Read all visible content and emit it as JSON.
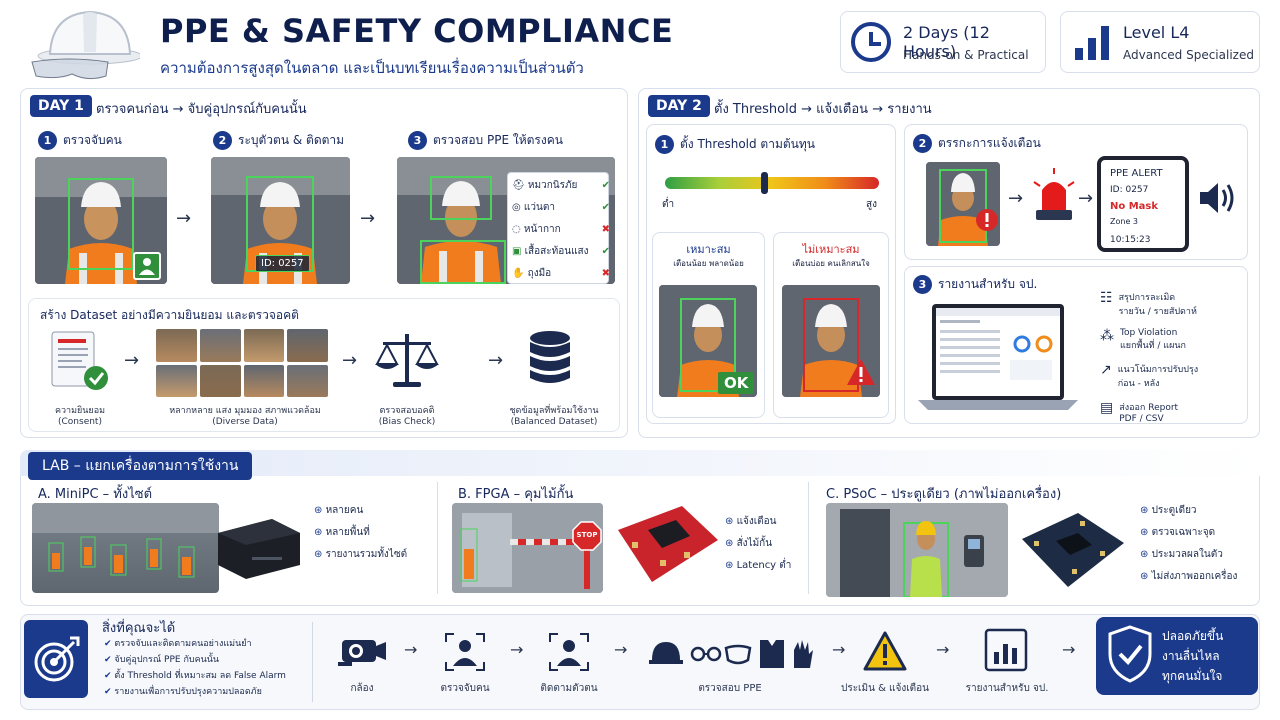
{
  "header": {
    "title": "PPE & SAFETY COMPLIANCE",
    "subtitle": "ความต้องการสูงสุดในตลาด และเป็นบทเรียนเรื่องความเป็นส่วนตัว",
    "duration_title": "2 Days (12 Hours)",
    "duration_sub": "Hands-on & Practical",
    "level_title": "Level L4",
    "level_sub": "Advanced Specialized"
  },
  "day1": {
    "tag": "DAY 1",
    "heading": "ตรวจคนก่อน → จับคู่อุปกรณ์กับคนนั้น",
    "steps": [
      {
        "num": "1",
        "label": "ตรวจจับคน"
      },
      {
        "num": "2",
        "label": "ระบุตัวตน & ติดตาม"
      },
      {
        "num": "3",
        "label": "ตรวจสอบ PPE ให้ตรงคน"
      }
    ],
    "id_label": "ID: 0257",
    "ppe_items": [
      {
        "label": "หมวกนิรภัย",
        "status": "✔"
      },
      {
        "label": "แว่นตา",
        "status": "✔"
      },
      {
        "label": "หน้ากาก",
        "status": "✖"
      },
      {
        "label": "เสื้อสะท้อนแสง",
        "status": "✔"
      },
      {
        "label": "ถุงมือ",
        "status": "✖"
      }
    ],
    "dataset_heading": "สร้าง Dataset อย่างมีความยินยอม และตรวจอคติ",
    "dataset_steps": [
      {
        "label": "ความยินยอม",
        "sub": "(Consent)"
      },
      {
        "label": "หลากหลาย แสง มุมมอง สภาพแวดล้อม",
        "sub": "(Diverse Data)"
      },
      {
        "label": "ตรวจสอบอคติ",
        "sub": "(Bias Check)"
      },
      {
        "label": "ชุดข้อมูลที่พร้อมใช้งาน",
        "sub": "(Balanced Dataset)"
      }
    ]
  },
  "day2": {
    "tag": "DAY 2",
    "heading": "ตั้ง Threshold → แจ้งเตือน → รายงาน",
    "step1": "ตั้ง Threshold ตามต้นทุน",
    "low": "ต่ำ",
    "high": "สูง",
    "good_title": "เหมาะสม",
    "good_sub": "เตือนน้อย พลาดน้อย",
    "good_badge": "OK",
    "bad_title": "ไม่เหมาะสม",
    "bad_sub": "เตือนบ่อย คนเลิกสนใจ",
    "step2": "ตรรกะการแจ้งเตือน",
    "alert": {
      "title": "PPE ALERT",
      "id": "ID: 0257",
      "status": "No Mask",
      "zone": "Zone 3",
      "time": "10:15:23"
    },
    "step3": "รายงานสำหรับ จป.",
    "report_items": [
      {
        "line1": "สรุปการละเมิด",
        "line2": "รายวัน / รายสัปดาห์"
      },
      {
        "line1": "Top Violation",
        "line2": "แยกพื้นที่ / แผนก"
      },
      {
        "line1": "แนวโน้มการปรับปรุง",
        "line2": "ก่อน - หลัง"
      },
      {
        "line1": "ส่งออก Report",
        "line2": "PDF / CSV"
      }
    ]
  },
  "lab": {
    "tag": "LAB – แยกเครื่องตามการใช้งาน",
    "a_title": "A. MiniPC – ทั้งไซต์",
    "a_items": [
      "หลายคน",
      "หลายพื้นที่",
      "รายงานรวมทั้งไซต์"
    ],
    "b_title": "B. FPGA – คุมไม้กั้น",
    "b_items": [
      "แจ้งเตือน",
      "สั่งไม้กั้น",
      "Latency ต่ำ"
    ],
    "b_stop": "STOP",
    "c_title": "C. PSoC – ประตูเดียว (ภาพไม่ออกเครื่อง)",
    "c_items": [
      "ประตูเดียว",
      "ตรวจเฉพาะจุด",
      "ประมวลผลในตัว",
      "ไม่ส่งภาพออกเครื่อง"
    ]
  },
  "outcomes": {
    "heading": "สิ่งที่คุณจะได้",
    "items": [
      "ตรวจจับและติดตามคนอย่างแม่นยำ",
      "จับคู่อุปกรณ์ PPE กับคนนั้น",
      "ตั้ง Threshold ที่เหมาะสม ลด False Alarm",
      "รายงานเพื่อการปรับปรุงความปลอดภัย"
    ],
    "flow": [
      "กล้อง",
      "ตรวจจับคน",
      "ติดตามตัวตน",
      "ตรวจสอบ PPE",
      "ประเมิน & แจ้งเตือน",
      "รายงานสำหรับ จป."
    ],
    "final": [
      "ปลอดภัยขึ้น",
      "งานลื่นไหล",
      "ทุกคนมั่นใจ"
    ]
  },
  "colors": {
    "navy": "#16275a",
    "accent": "#1b3a8c",
    "ok": "#2f8f3a",
    "bad": "#d62828",
    "vest": "#f07c1e"
  }
}
